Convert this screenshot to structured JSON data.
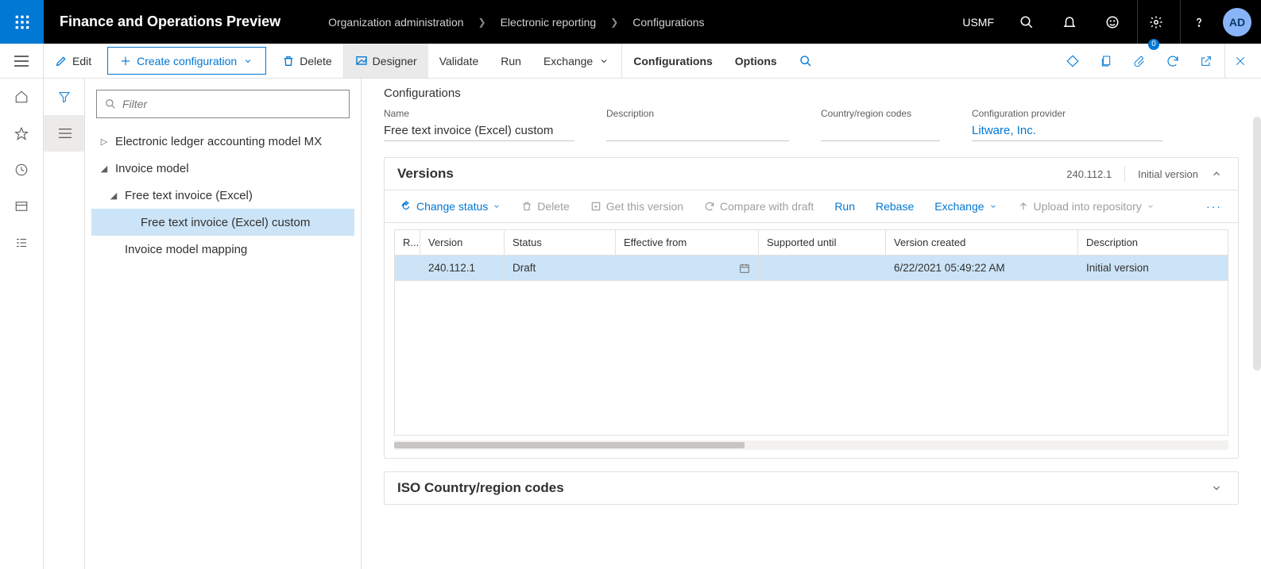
{
  "header": {
    "app_title": "Finance and Operations Preview",
    "breadcrumbs": [
      "Organization administration",
      "Electronic reporting",
      "Configurations"
    ],
    "company": "USMF",
    "avatar": "AD"
  },
  "actionbar": {
    "edit": "Edit",
    "create": "Create configuration",
    "delete": "Delete",
    "designer": "Designer",
    "validate": "Validate",
    "run": "Run",
    "exchange": "Exchange",
    "configurations_tab": "Configurations",
    "options_tab": "Options",
    "badge_count": "0"
  },
  "filter": {
    "placeholder": "Filter"
  },
  "tree": {
    "n0": "Electronic ledger accounting model MX",
    "n1": "Invoice model",
    "n2": "Free text invoice (Excel)",
    "n3": "Free text invoice (Excel) custom",
    "n4": "Invoice model mapping"
  },
  "detail": {
    "caption": "Configurations",
    "labels": {
      "name": "Name",
      "description": "Description",
      "cc": "Country/region codes",
      "provider": "Configuration provider"
    },
    "name": "Free text invoice (Excel) custom",
    "description": "",
    "cc": "",
    "provider": "Litware, Inc."
  },
  "versions": {
    "title": "Versions",
    "summary_version": "240.112.1",
    "summary_desc": "Initial version",
    "toolbar": {
      "change_status": "Change status",
      "delete": "Delete",
      "get": "Get this version",
      "compare": "Compare with draft",
      "run": "Run",
      "rebase": "Rebase",
      "exchange": "Exchange",
      "upload": "Upload into repository"
    },
    "chart_data": {
      "type": "table",
      "columns": [
        "R...",
        "Version",
        "Status",
        "Effective from",
        "Supported until",
        "Version created",
        "Description"
      ],
      "rows": [
        {
          "r": "",
          "version": "240.112.1",
          "status": "Draft",
          "effective_from": "",
          "supported_until": "",
          "version_created": "6/22/2021 05:49:22 AM",
          "description": "Initial version"
        }
      ]
    },
    "columns": {
      "r": "R...",
      "version": "Version",
      "status": "Status",
      "effective": "Effective from",
      "supported": "Supported until",
      "created": "Version created",
      "description": "Description"
    },
    "rows": [
      {
        "r": "",
        "version": "240.112.1",
        "status": "Draft",
        "effective": "",
        "supported": "",
        "created": "6/22/2021 05:49:22 AM",
        "description": "Initial version"
      }
    ]
  },
  "iso_section": {
    "title": "ISO Country/region codes"
  }
}
